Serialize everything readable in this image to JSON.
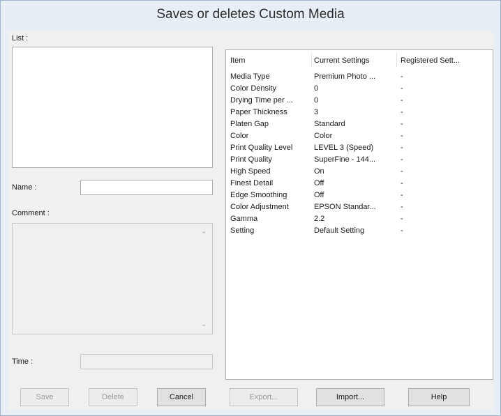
{
  "window": {
    "title": "Saves or deletes Custom Media"
  },
  "left": {
    "list_label": "List :",
    "name_label": "Name :",
    "name_value": "",
    "comment_label": "Comment :",
    "time_label": "Time :",
    "time_value": ""
  },
  "table": {
    "headers": [
      "Item",
      "Current Settings",
      "Registered Sett..."
    ],
    "rows": [
      [
        "Media Type",
        "Premium Photo ...",
        "-"
      ],
      [
        "Color Density",
        "0",
        "-"
      ],
      [
        "Drying Time per ...",
        "0",
        "-"
      ],
      [
        "Paper Thickness",
        "3",
        "-"
      ],
      [
        "Platen Gap",
        "Standard",
        "-"
      ],
      [
        "Color",
        "Color",
        "-"
      ],
      [
        "Print Quality Level",
        "LEVEL 3 (Speed)",
        "-"
      ],
      [
        "Print Quality",
        "SuperFine - 144...",
        "-"
      ],
      [
        "High Speed",
        "On",
        "-"
      ],
      [
        "Finest Detail",
        "Off",
        "-"
      ],
      [
        "Edge Smoothing",
        "Off",
        "-"
      ],
      [
        "Color Adjustment",
        "EPSON Standar...",
        "-"
      ],
      [
        "Gamma",
        "2.2",
        "-"
      ],
      [
        "Setting",
        "Default Setting",
        "-"
      ]
    ]
  },
  "buttons": {
    "save": "Save",
    "delete": "Delete",
    "cancel": "Cancel",
    "export": "Export...",
    "import": "Import...",
    "help": "Help"
  }
}
